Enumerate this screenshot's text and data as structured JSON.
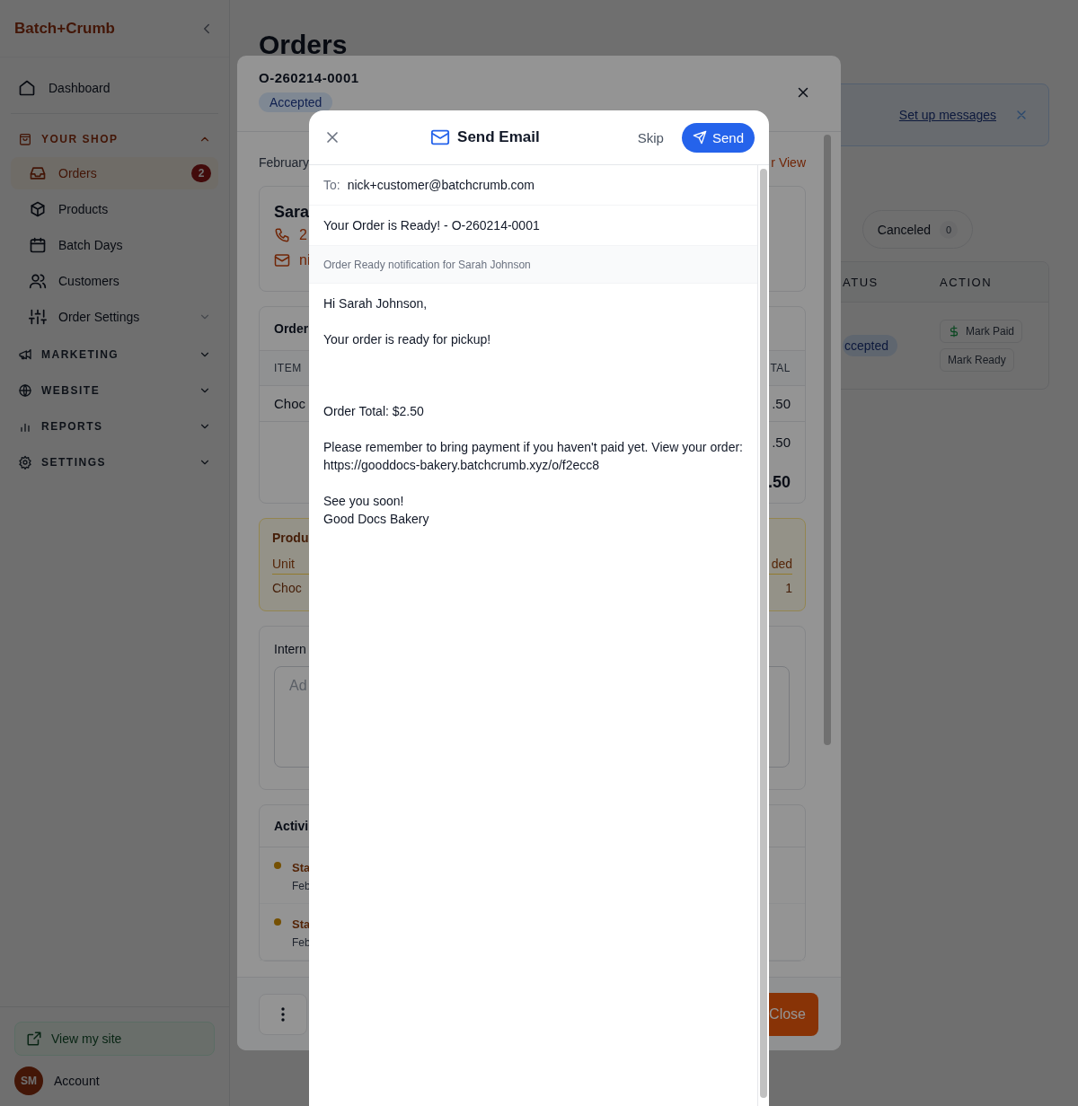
{
  "sidebar": {
    "logo": "Batch+Crumb",
    "items": [
      {
        "label": "Dashboard",
        "selected": false
      }
    ],
    "groups": [
      {
        "label": "YOUR SHOP",
        "expanded": true,
        "items": [
          {
            "label": "Orders",
            "kind": "link",
            "selected": true,
            "badge": "2"
          },
          {
            "label": "Products",
            "kind": "link",
            "selected": false
          },
          {
            "label": "Batch Days",
            "kind": "link",
            "selected": false
          },
          {
            "label": "Customers",
            "kind": "link",
            "selected": false
          },
          {
            "label": "Order Settings",
            "kind": "submenu",
            "selected": false,
            "expanded": false
          }
        ]
      },
      {
        "label": "MARKETING",
        "expanded": false
      },
      {
        "label": "WEBSITE",
        "expanded": false
      },
      {
        "label": "REPORTS",
        "expanded": false
      },
      {
        "label": "SETTINGS",
        "expanded": false
      }
    ],
    "view_site": "View my site",
    "account": {
      "initials": "SM",
      "label": "Account"
    }
  },
  "page": {
    "title": "Orders",
    "banner": {
      "link": "Set up messages"
    },
    "filters": [
      {
        "label": "Canceled",
        "count": "0",
        "selected": false
      }
    ],
    "table": {
      "columns": [
        "ATUS",
        "ACTION"
      ],
      "rows": [
        {
          "status": "ccepted",
          "actions": [
            "Mark Paid",
            "Mark Ready"
          ]
        }
      ]
    }
  },
  "order_modal": {
    "order_number": "O-260214-0001",
    "status": "Accepted",
    "date": "February",
    "view_link": "r View",
    "customer": {
      "name": "Sara",
      "phone": "2",
      "email": "ni"
    },
    "items_card": {
      "title": "Order",
      "columns": [
        "ITEM",
        "TAL"
      ],
      "rows": [
        {
          "item": "Choc",
          "total": ".50"
        }
      ],
      "subtotal": ".50",
      "total": ".50"
    },
    "production": {
      "title": "Produ",
      "columns": [
        "Unit",
        "ded"
      ],
      "rows": [
        {
          "name": "Choc",
          "needed": "1"
        }
      ]
    },
    "notes": {
      "title": "Intern",
      "placeholder": "Ad"
    },
    "activity": {
      "title": "Activi",
      "items": [
        {
          "title": "Sta",
          "date": "Feb"
        },
        {
          "title": "Sta",
          "date": "Feb"
        }
      ]
    },
    "close_button": "Close"
  },
  "email_modal": {
    "title": "Send Email",
    "skip": "Skip",
    "send": "Send",
    "to_label": "To:",
    "to": "nick+customer@batchcrumb.com",
    "subject": "Your Order is Ready! - O-260214-0001",
    "template": "Order Ready notification for Sarah Johnson",
    "body": "Hi Sarah Johnson,\n\nYour order is ready for pickup!\n\n\n\nOrder Total: $2.50\n\nPlease remember to bring payment if you haven't paid yet. View your order: https://gooddocs-bakery.batchcrumb.xyz/o/f2ecc8\n\nSee you soon!\nGood Docs Bakery"
  }
}
